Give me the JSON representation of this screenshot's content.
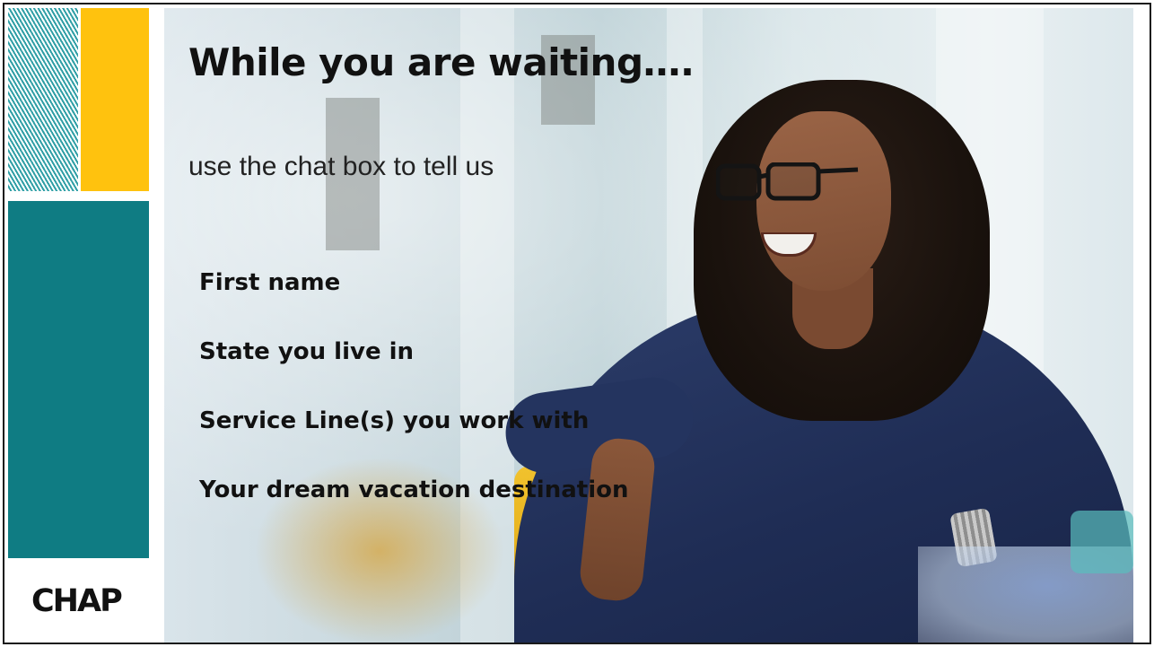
{
  "slide": {
    "title": "While you are waiting….",
    "subtitle": "use the chat box to  tell us",
    "prompts": [
      "First name",
      "State you live in",
      "Service Line(s) you work with",
      "Your dream vacation destination"
    ],
    "logo_text": "CHAP"
  },
  "colors": {
    "yellow_accent": "#ffc20e",
    "teal_accent": "#0f7c83",
    "stripe_teal": "#2f9fa6"
  }
}
